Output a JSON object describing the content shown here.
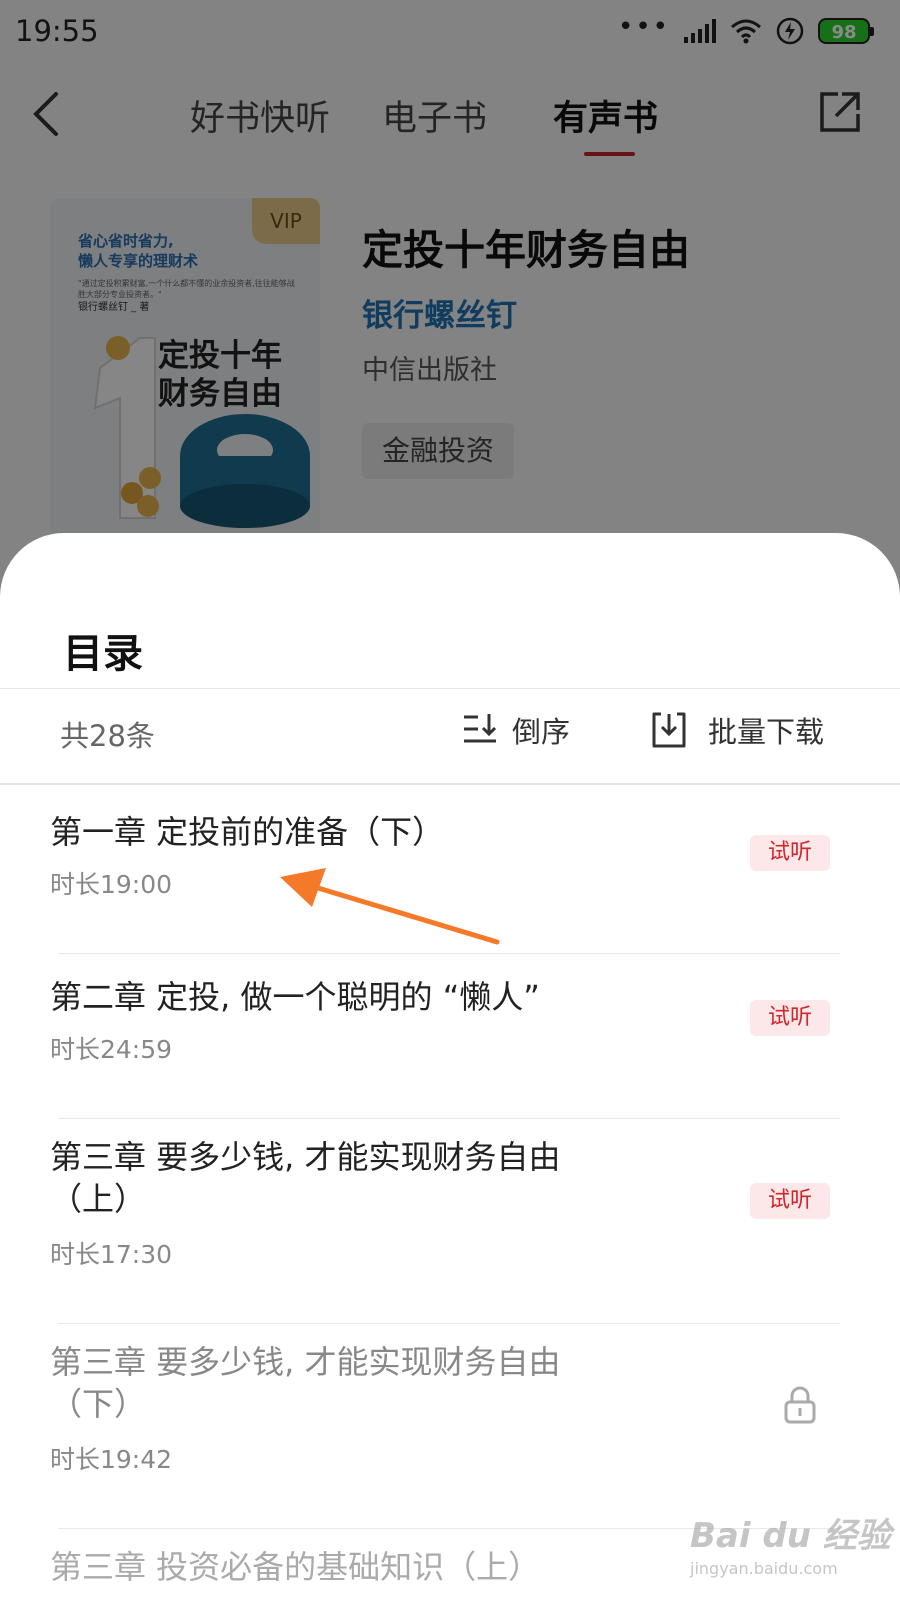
{
  "status_bar": {
    "time": "19:55",
    "battery": "98"
  },
  "nav": {
    "tabs": [
      {
        "label": "好书快听"
      },
      {
        "label": "电子书"
      },
      {
        "label": "有声书",
        "active": true
      }
    ]
  },
  "book": {
    "cover": {
      "vip": "VIP",
      "slogan_line1": "省心省时省力,",
      "slogan_line2": "懒人专享的理财术",
      "quote": "\"通过定投积累财富,一个什么都不懂的业余投资者,往往能够战胜大部分专业投资者。\"",
      "author": "银行螺丝钉 _ 著",
      "title_line1": "定投十年",
      "title_line2": "财务自由"
    },
    "title": "定投十年财务自由",
    "author": "银行螺丝钉",
    "publisher": "中信出版社",
    "tag": "金融投资"
  },
  "toc": {
    "title": "目录",
    "count": "共28条",
    "sort_label": "倒序",
    "download_label": "批量下载",
    "chapters": [
      {
        "title": "第一章 定投前的准备（下）",
        "duration": "时长19:00",
        "badge": "试听"
      },
      {
        "title": "第二章 定投, 做一个聪明的 “懒人”",
        "duration": "时长24:59",
        "badge": "试听"
      },
      {
        "title": "第三章 要多少钱, 才能实现财务自由（上）",
        "duration": "时长17:30",
        "badge": "试听"
      },
      {
        "title": "第三章 要多少钱, 才能实现财务自由（下）",
        "duration": "时长19:42",
        "locked": true
      },
      {
        "title": "第三章 投资必备的基础知识（上）",
        "duration": ""
      }
    ]
  },
  "colors": {
    "accent": "#c0262b",
    "trial_bg": "#fde8e9",
    "trial_text": "#d0262c",
    "author_link": "#1f6fb2",
    "annotation_arrow": "#f47a2a"
  },
  "watermark": {
    "logo": "Bai du 经验",
    "url": "jingyan.baidu.com"
  }
}
